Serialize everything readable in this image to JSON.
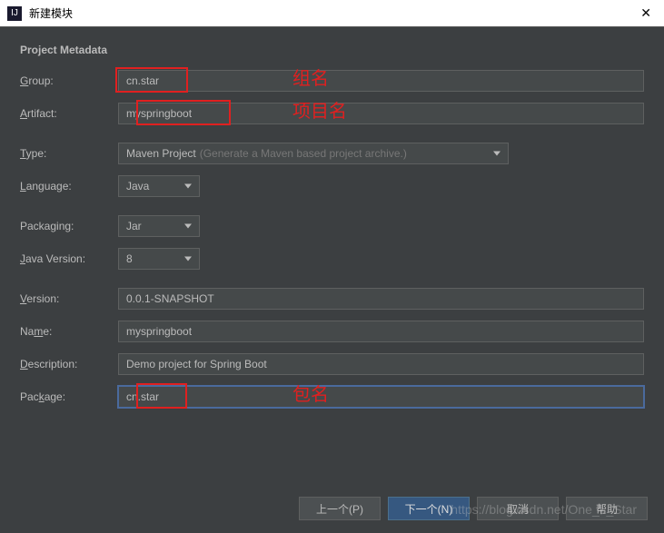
{
  "window": {
    "title": "新建模块"
  },
  "section_title": "Project Metadata",
  "fields": {
    "group": {
      "label": "Group:",
      "hotkey": "G",
      "value": "cn.star"
    },
    "artifact": {
      "label": "Artifact:",
      "hotkey": "A",
      "value": "myspringboot"
    },
    "type": {
      "label": "Type:",
      "hotkey": "T",
      "value": "Maven Project",
      "hint": "(Generate a Maven based project archive.)"
    },
    "language": {
      "label": "Language:",
      "hotkey": "L",
      "value": "Java"
    },
    "packaging": {
      "label": "Packaging:",
      "hotkey": "P",
      "value": "Jar"
    },
    "javaVersion": {
      "label": "Java Version:",
      "hotkey": "J",
      "value": "8"
    },
    "version": {
      "label": "Version:",
      "hotkey": "V",
      "value": "0.0.1-SNAPSHOT"
    },
    "name": {
      "label": "Name:",
      "hotkey": "N",
      "value": "myspringboot"
    },
    "description": {
      "label": "Description:",
      "hotkey": "D",
      "value": "Demo project for Spring Boot"
    },
    "package": {
      "label": "Package:",
      "hotkey": "P",
      "value": "cn.star"
    }
  },
  "annotations": {
    "group": "组名",
    "artifact": "项目名",
    "package": "包名"
  },
  "buttons": {
    "prev": "上一个(P)",
    "next": "下一个(N)",
    "cancel": "取消",
    "help": "帮助"
  },
  "watermark": "https://blog.csdn.net/One_L_Star"
}
